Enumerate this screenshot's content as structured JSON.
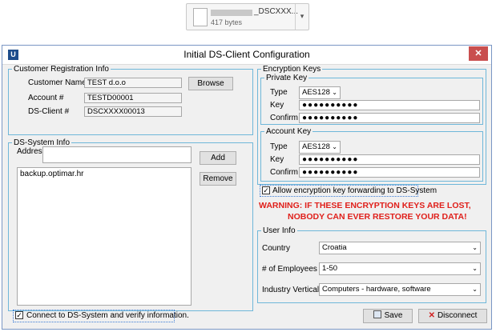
{
  "file_chip": {
    "name": "_DSCXXX...",
    "size": "417 bytes"
  },
  "window": {
    "title": "Initial DS-Client Configuration",
    "close_glyph": "✕",
    "icon_glyph": "U"
  },
  "customer_registration": {
    "legend": "Customer Registration Info",
    "customer_name_label": "Customer Name",
    "customer_name_value": "TEST d.o.o",
    "account_label": "Account #",
    "account_value": "TESTD00001",
    "ds_client_label": "DS-Client #",
    "ds_client_value": "DSCXXXX00013",
    "browse_label": "Browse"
  },
  "ds_system": {
    "legend": "DS-System Info",
    "address_label": "Address",
    "address_value": "",
    "add_label": "Add",
    "remove_label": "Remove",
    "addresses": [
      "backup.optimar.hr"
    ]
  },
  "encryption": {
    "legend": "Encryption Keys",
    "private": {
      "legend": "Private Key",
      "type_label": "Type",
      "type_value": "AES128",
      "key_label": "Key",
      "key_value": "●●●●●●●●●●",
      "confirm_label": "Confirm",
      "confirm_value": "●●●●●●●●●●"
    },
    "account": {
      "legend": "Account Key",
      "type_label": "Type",
      "type_value": "AES128",
      "key_label": "Key",
      "key_value": "●●●●●●●●●●",
      "confirm_label": "Confirm",
      "confirm_value": "●●●●●●●●●●"
    },
    "allow_forwarding_label": "Allow encryption key forwarding to DS-System",
    "allow_forwarding_checked": true
  },
  "warning": {
    "line1": "WARNING:  IF THESE ENCRYPTION KEYS ARE LOST,",
    "line2": "NOBODY CAN EVER RESTORE YOUR DATA!"
  },
  "user_info": {
    "legend": "User Info",
    "country_label": "Country",
    "country_value": "Croatia",
    "employees_label": "# of Employees",
    "employees_value": "1-50",
    "industry_label": "Industry Vertical",
    "industry_value": "Computers - hardware, software"
  },
  "footer": {
    "connect_label": "Connect to DS-System and verify information.",
    "connect_checked": true,
    "save_label": "Save",
    "disconnect_label": "Disconnect"
  },
  "colors": {
    "warning": "#e0201b",
    "group_border": "#6fb7d9",
    "window_border": "#7a96c4"
  }
}
